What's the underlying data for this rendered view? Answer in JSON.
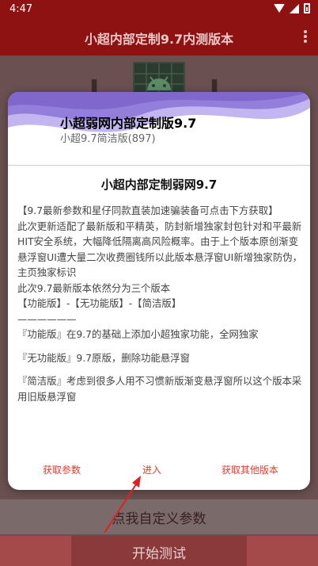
{
  "statusbar": {
    "time": "4:47"
  },
  "appbar": {
    "title": "小超内部定制9.7内测版本"
  },
  "background": {
    "glyph_left": "卜",
    "glyph_right": "卜",
    "custom_params": "点我自定义参数",
    "start_test": "开始测试"
  },
  "dialog": {
    "header_title": "小超弱网内部定制版9.7",
    "header_subtitle": "小超9.7简洁版(897)",
    "card_title": "小超内部定制弱网9.7",
    "lines": [
      "【9.7最新参数和星仔同款直装加速骗装备可点击下方获取】",
      "此次更新适配了最新版和平精英，防封新增独家封包针对和平最新HIT安全系统，大幅降低隔离高风险概率。由于上个版本原创渐变悬浮窗UI遭大量二次收费圈钱所以此版本悬浮窗UI新增独家防伪，主页独家标识",
      "此次9.7最新版本依然分为三个版本",
      "【功能版】-【无功能版】-【简洁版】",
      "——————",
      "『功能版』在9.7的基础上添加小超独家功能，全网独家",
      "『无功能版』9.7原版，删除功能悬浮窗",
      "『简洁版』考虑到很多人用不习惯新版渐变悬浮窗所以这个版本采用旧版悬浮窗"
    ],
    "buttons": {
      "get_params": "获取参数",
      "enter": "进入",
      "other_versions": "获取其他版本"
    }
  },
  "colors": {
    "appbar": "#8e1212",
    "accent_text": "#e23a2f",
    "wave_purple": "#8f78d8"
  }
}
